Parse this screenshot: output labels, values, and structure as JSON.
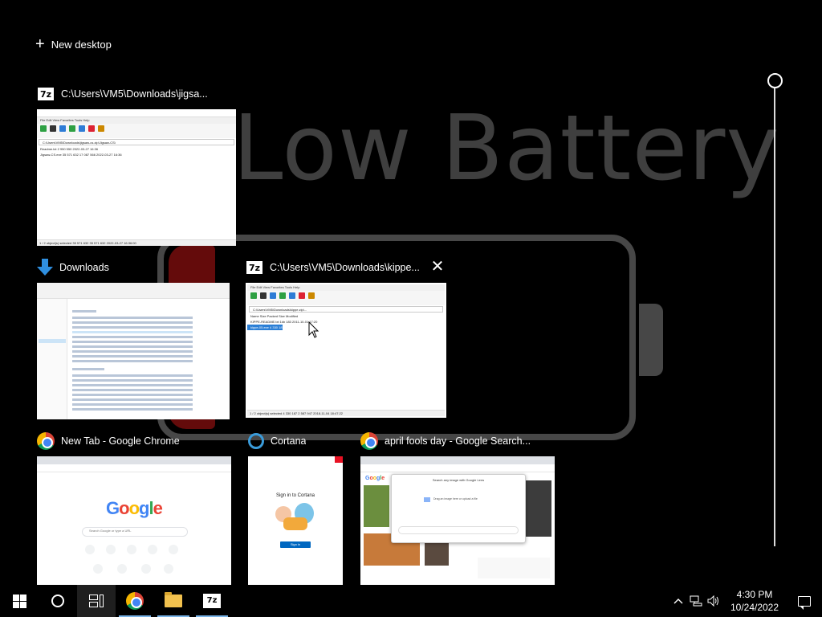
{
  "task_view": {
    "new_desktop_label": "New desktop",
    "wallpaper_text": "Low Battery",
    "windows": [
      {
        "id": "jigsaw",
        "app_icon": "7z-icon",
        "title": "C:\\Users\\VM5\\Downloads\\jigsa..."
      },
      {
        "id": "downloads",
        "app_icon": "download-icon",
        "title": "Downloads"
      },
      {
        "id": "kippe",
        "app_icon": "7z-icon",
        "title": "C:\\Users\\VM5\\Downloads\\kippe..."
      },
      {
        "id": "newtab",
        "app_icon": "chrome-icon",
        "title": "New Tab - Google Chrome"
      },
      {
        "id": "cortana",
        "app_icon": "cortana-icon",
        "title": "Cortana"
      },
      {
        "id": "aprilfools",
        "app_icon": "chrome-icon",
        "title": "april fools day - Google Search..."
      }
    ],
    "thumbnails": {
      "jigsaw": {
        "menu": "File  Edit  View  Favorites  Tools  Help",
        "address": "C:\\Users\\VM5\\Downloads\\jigsaw-cs.zip\\Jigsaw-CS\\",
        "rows": [
          "Readme.txt        2 950      550    2022-03-27 16:36",
          "Jigsaw-CS.exe   35 571 632  17 087 566  2022-03-27 16:36"
        ],
        "status": "1 / 2 object(s) selected     35 571 632     35 571 632     2022-03-27 16:36:00"
      },
      "kippe": {
        "menu": "File  Edit  View  Favorites  Tools  Help",
        "address": "C:\\Users\\VM5\\Downloads\\kippe.zip\\...",
        "headers": "Name                       Size      Packed Size     Modified",
        "rows": [
          "KIPPE-README.txt      1kb       183   2011-10-01 17:20",
          "kippe-05.exe           4 330 187  2 587 691  2018-11-04 18:47"
        ],
        "status": "1 / 2 object(s) selected      4 330 187     2 587 947     2018-11-04 18:47:22"
      },
      "newtab": {
        "search_placeholder": "Search Google or type a URL",
        "logo": "Google"
      },
      "cortana": {
        "heading": "Sign in to Cortana",
        "button": "Sign in"
      },
      "aprilfools": {
        "dialog_title": "Search any image with Google Lens",
        "dialog_hint": "Drag an image here or upload a file",
        "logo": "Google"
      }
    }
  },
  "taskbar": {
    "items": [
      {
        "name": "start-button",
        "label": "Start"
      },
      {
        "name": "search-button",
        "label": "Search"
      },
      {
        "name": "task-view-button",
        "label": "Task View"
      },
      {
        "name": "chrome-taskbar-button",
        "label": "Google Chrome"
      },
      {
        "name": "file-explorer-taskbar-button",
        "label": "File Explorer"
      },
      {
        "name": "7zip-taskbar-button",
        "label": "7-Zip"
      }
    ],
    "tray": {
      "time": "4:30 PM",
      "date": "10/24/2022"
    }
  },
  "colors": {
    "accent": "#7ab4e8",
    "selection": "#2b7fd6",
    "battery_red": "#640b0b"
  }
}
